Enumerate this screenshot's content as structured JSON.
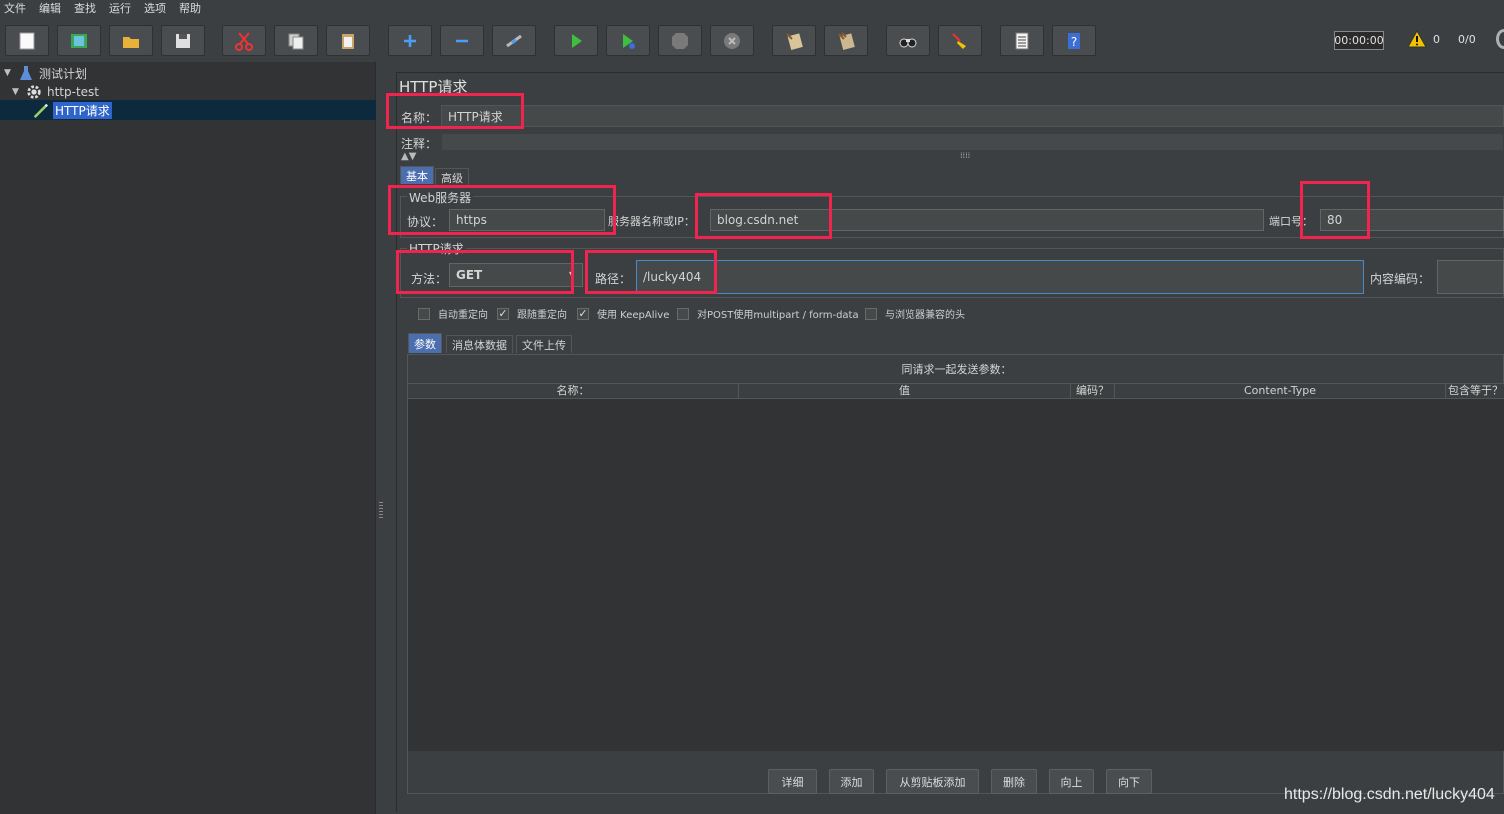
{
  "menu": [
    "文件",
    "编辑",
    "查找",
    "运行",
    "选项",
    "帮助"
  ],
  "toolbar": {
    "timer": "00:00:00",
    "warning_count": "0",
    "threads": "0/0"
  },
  "tree": {
    "root": "测试计划",
    "thread_group": "http-test",
    "sampler": "HTTP请求"
  },
  "panel": {
    "title": "HTTP请求",
    "name_label": "名称：",
    "name_value": "HTTP请求",
    "comment_label": "注释：",
    "tabs": [
      "基本",
      "高级"
    ],
    "web_server": {
      "title": "Web服务器",
      "protocol_label": "协议：",
      "protocol_value": "https",
      "server_label": "服务器名称或IP：",
      "server_value": "blog.csdn.net",
      "port_label": "端口号：",
      "port_value": "80"
    },
    "http_request": {
      "title": "HTTP请求",
      "method_label": "方法：",
      "method_value": "GET",
      "path_label": "路径：",
      "path_value": "/lucky404",
      "encoding_label": "内容编码："
    },
    "checkboxes": [
      {
        "label": "自动重定向",
        "checked": false
      },
      {
        "label": "跟随重定向",
        "checked": true
      },
      {
        "label": "使用 KeepAlive",
        "checked": true
      },
      {
        "label": "对POST使用multipart / form-data",
        "checked": false
      },
      {
        "label": "与浏览器兼容的头",
        "checked": false
      }
    ],
    "subtabs": [
      "参数",
      "消息体数据",
      "文件上传"
    ],
    "table_caption": "同请求一起发送参数：",
    "columns": [
      "名称：",
      "值",
      "编码？",
      "Content-Type",
      "包含等于？"
    ],
    "buttons": [
      "详细",
      "添加",
      "从剪贴板添加",
      "删除",
      "向上",
      "向下"
    ]
  },
  "watermark": "https://blog.csdn.net/lucky404",
  "colors": {
    "background": "#3c3f41",
    "highlight": "#f0244e",
    "selection": "#2f65ca"
  }
}
